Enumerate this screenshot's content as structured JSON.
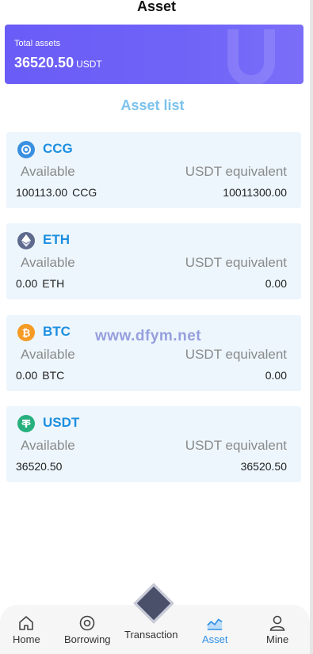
{
  "header": {
    "title": "Asset"
  },
  "total": {
    "label": "Total assets",
    "amount": "36520.50",
    "unit": "USDT"
  },
  "list_title": "Asset list",
  "labels": {
    "available": "Available",
    "equiv": "USDT equivalent"
  },
  "assets": [
    {
      "name": "CCG",
      "amount": "100113.00",
      "coin": "CCG",
      "equiv": "10011300.00",
      "icon": "ccg-icon",
      "color": "#3a8fe0"
    },
    {
      "name": "ETH",
      "amount": "0.00",
      "coin": "ETH",
      "equiv": "0.00",
      "icon": "eth-icon",
      "color": "#5f6a8e"
    },
    {
      "name": "BTC",
      "amount": "0.00",
      "coin": "BTC",
      "equiv": "0.00",
      "icon": "btc-icon",
      "color": "#f59a23"
    },
    {
      "name": "USDT",
      "amount": "36520.50",
      "coin": "",
      "equiv": "36520.50",
      "icon": "usdt-icon",
      "color": "#27b07d"
    }
  ],
  "watermark": "www.dfym.net",
  "tabbar": {
    "items": [
      {
        "label": "Home",
        "icon": "home-icon"
      },
      {
        "label": "Borrowing",
        "icon": "target-icon"
      },
      {
        "label": "Transaction",
        "icon": "diamond-icon"
      },
      {
        "label": "Asset",
        "icon": "chart-icon",
        "active": true
      },
      {
        "label": "Mine",
        "icon": "user-icon"
      }
    ]
  },
  "colors": {
    "accent": "#2f8fe6",
    "card_bg": "#edf6fd",
    "banner": "#6a5cf7"
  }
}
